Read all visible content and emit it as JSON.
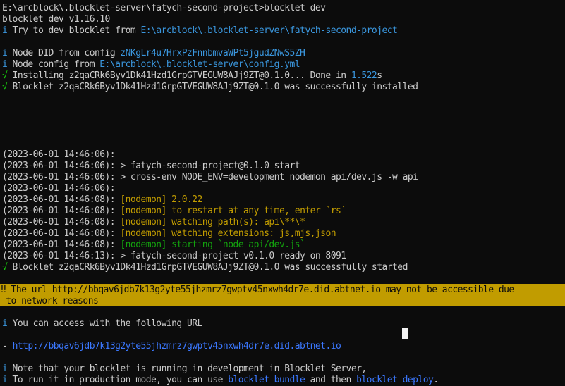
{
  "terminal": {
    "prompt": "E:\\arcblock\\.blocklet-server\\fatych-second-project>blocklet dev",
    "version": "blocklet dev v1.16.10",
    "try_dev": {
      "icon": "i",
      "text": " Try to dev blocklet from ",
      "path": "E:\\arcblock\\.blocklet-server\\fatych-second-project"
    },
    "node_did": {
      "icon": "i",
      "text": " Node DID from config ",
      "value": "zNKgLr4u7HrxPzFnnbmvaWPt5jgudZNwS5ZH"
    },
    "node_config": {
      "icon": "i",
      "text": " Node config from ",
      "path": "E:\\arcblock\\.blocklet-server\\config.yml"
    },
    "installing": {
      "icon": "√",
      "text": " Installing z2qaCRk6Byv1Dk41Hzd1GrpGTVEGUW8AJj9ZT@0.1.0... Done in ",
      "time": "1.522",
      "unit": "s"
    },
    "installed": {
      "icon": "√",
      "text": " Blocklet z2qaCRk6Byv1Dk41Hzd1GrpGTVEGUW8AJj9ZT@0.1.0 was successfully installed"
    },
    "logs": [
      {
        "ts": "(2023-06-01 14:46:06):",
        "tag": "",
        "msg": ""
      },
      {
        "ts": "(2023-06-01 14:46:06):",
        "tag": "",
        "msg": " > fatych-second-project@0.1.0 start"
      },
      {
        "ts": "(2023-06-01 14:46:06):",
        "tag": "",
        "msg": " > cross-env NODE_ENV=development nodemon api/dev.js -w api"
      },
      {
        "ts": "(2023-06-01 14:46:06):",
        "tag": "",
        "msg": ""
      },
      {
        "ts": "(2023-06-01 14:46:08):",
        "tag": " [nodemon]",
        "msg": " 2.0.22"
      },
      {
        "ts": "(2023-06-01 14:46:08):",
        "tag": " [nodemon]",
        "msg": " to restart at any time, enter `rs`"
      },
      {
        "ts": "(2023-06-01 14:46:08):",
        "tag": " [nodemon]",
        "msg": " watching path(s): api\\**\\*"
      },
      {
        "ts": "(2023-06-01 14:46:08):",
        "tag": " [nodemon]",
        "msg": " watching extensions: js,mjs,json"
      },
      {
        "ts": "(2023-06-01 14:46:08):",
        "tag": " [nodemon]",
        "msg": " starting `node api/dev.js`"
      },
      {
        "ts": "(2023-06-01 14:46:13):",
        "tag": "",
        "msg": " > fatych-second-project v0.1.0 ready on 8091"
      }
    ],
    "started": {
      "icon": "√",
      "text": " Blocklet z2qaCRk6Byv1Dk41Hzd1GrpGTVEGUW8AJj9ZT@0.1.0 was successfully started"
    },
    "warning": {
      "icon": "‼",
      "line1": " The url http://bbqav6jdb7k13g2yte55jhzmrz7gwptv45nxwh4dr7e.did.abtnet.io may not be accessible due",
      "line2": " to network reasons"
    },
    "access": {
      "icon": "i",
      "text": " You can access with the following URL"
    },
    "url": {
      "bullet": "-",
      "link": "http://bbqav6jdb7k13g2yte55jhzmrz7gwptv45nxwh4dr7e.did.abtnet.io"
    },
    "note": {
      "icon": "i",
      "text": " Note that your blocklet is running in development in Blocklet Server,"
    },
    "production": {
      "icon": "i",
      "text1": " To run it in production mode, you can use ",
      "cmd1": "blocklet bundle",
      "text2": " and then ",
      "cmd2": "blocklet deploy",
      "text3": "."
    },
    "colors": {
      "background": "#0c0c0c",
      "text": "#cccccc",
      "info": "#3a96dd",
      "success": "#16c60c",
      "nodemon": "#c19c00",
      "warning_bg": "#c19c00",
      "link": "#3b78ff"
    }
  }
}
